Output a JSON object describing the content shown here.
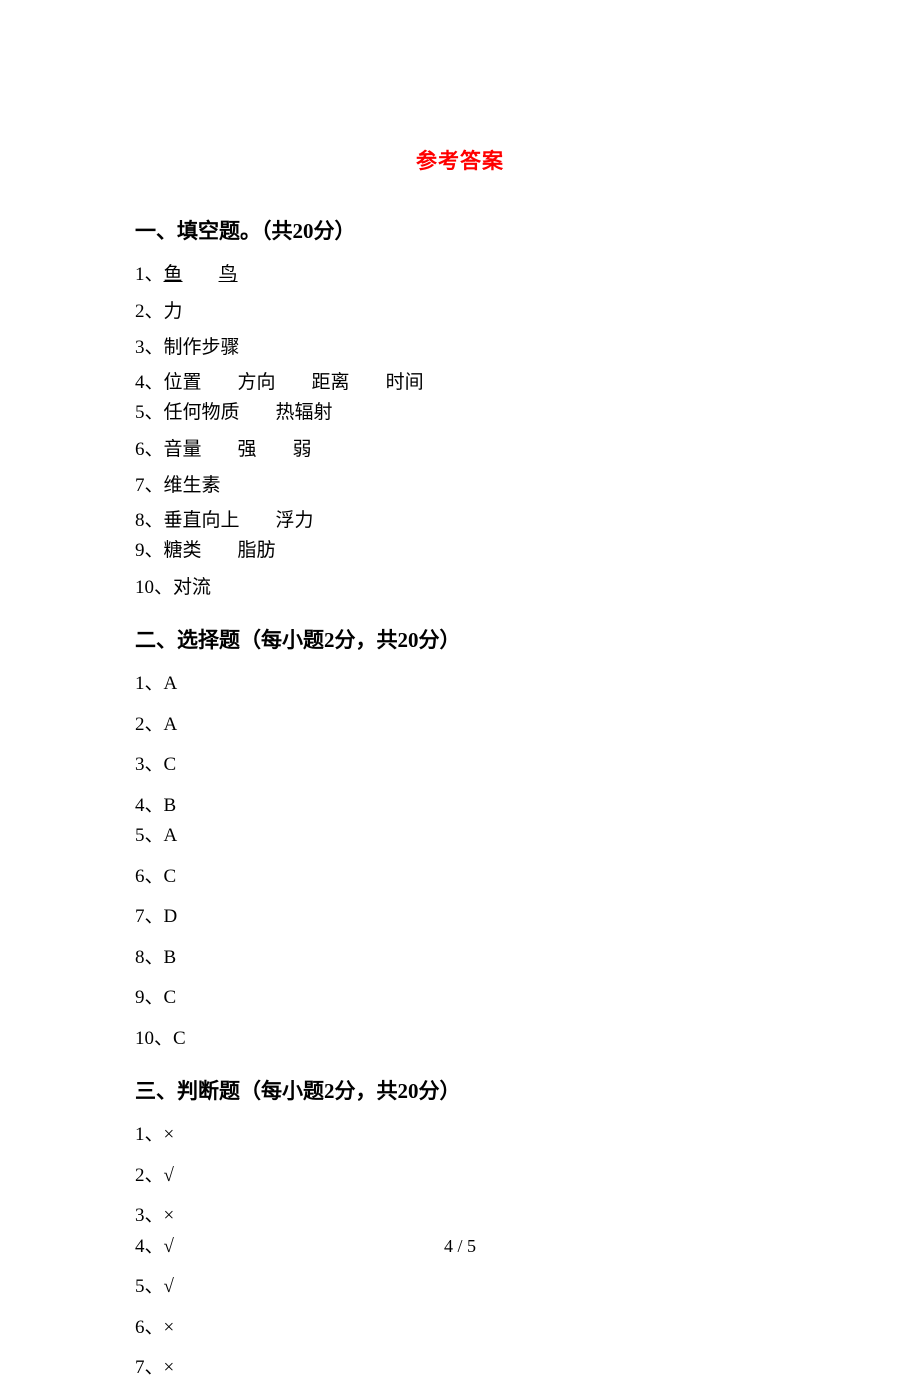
{
  "title": "参考答案",
  "sections": {
    "s1": {
      "heading": "一、填空题。（共20分）",
      "a1_num": "1、",
      "a1_p1": "鱼",
      "a1_p2": "鸟",
      "a2": "2、力",
      "a3": "3、制作步骤",
      "a4_num": "4、",
      "a4_p1": "位置",
      "a4_p2": "方向",
      "a4_p3": "距离",
      "a4_p4": "时间",
      "a5_num": "5、",
      "a5_p1": "任何物质",
      "a5_p2": "热辐射",
      "a6_num": "6、",
      "a6_p1": "音量",
      "a6_p2": "强",
      "a6_p3": "弱",
      "a7": "7、维生素",
      "a8_num": "8、",
      "a8_p1": "垂直向上",
      "a8_p2": "浮力",
      "a9_num": "9、",
      "a9_p1": "糖类",
      "a9_p2": "脂肪",
      "a10": "10、对流"
    },
    "s2": {
      "heading": "二、选择题（每小题2分，共20分）",
      "a1": "1、A",
      "a2": "2、A",
      "a3": "3、C",
      "a4": "4、B",
      "a5": "5、A",
      "a6": "6、C",
      "a7": "7、D",
      "a8": "8、B",
      "a9": "9、C",
      "a10": "10、C"
    },
    "s3": {
      "heading": "三、判断题（每小题2分，共20分）",
      "a1": "1、×",
      "a2": "2、√",
      "a3": "3、×",
      "a4": "4、√",
      "a5": "5、√",
      "a6": "6、×",
      "a7": "7、×"
    }
  },
  "page_number": "4 / 5"
}
